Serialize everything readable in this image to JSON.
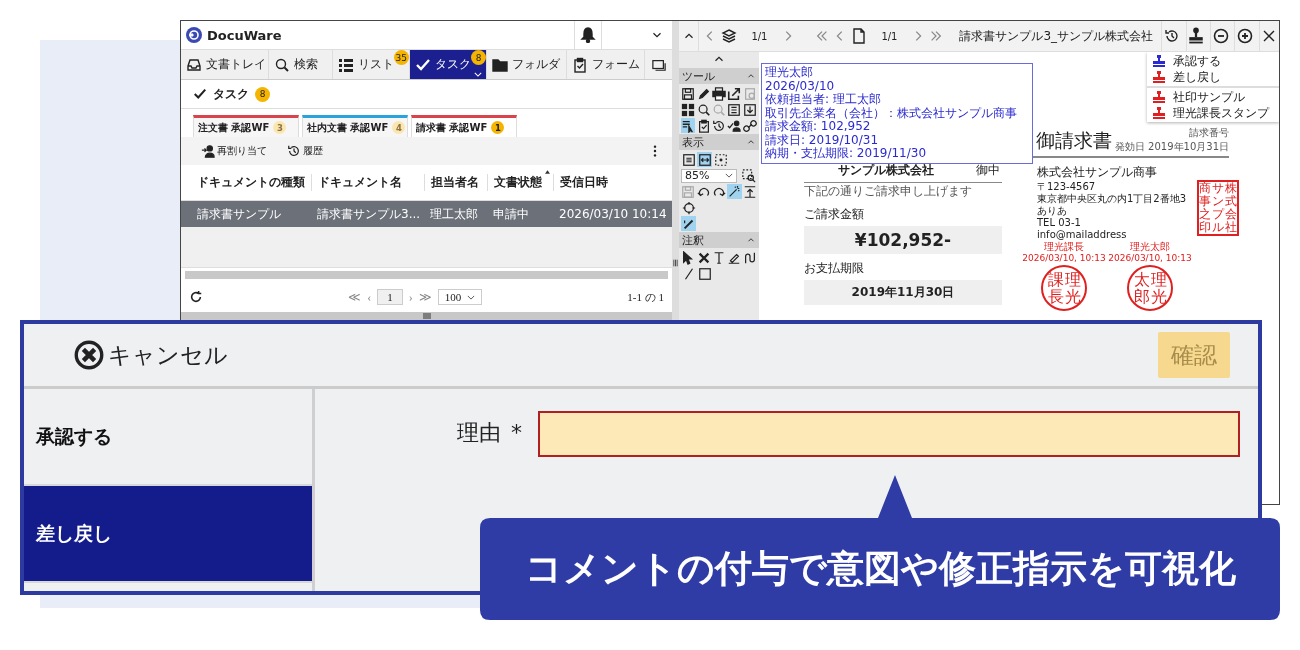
{
  "app": {
    "logo": "DocuWare",
    "nav_tabs": [
      {
        "label": "文書トレイ",
        "kind": "tray",
        "selected": false
      },
      {
        "label": "検索",
        "kind": "search",
        "selected": false
      },
      {
        "label": "リスト",
        "kind": "list",
        "badge": "35",
        "selected": false
      },
      {
        "label": "タスク",
        "kind": "check",
        "badge": "8",
        "selected": true
      },
      {
        "label": "フォルダ",
        "kind": "folder",
        "selected": false
      },
      {
        "label": "フォーム",
        "kind": "form",
        "selected": false
      }
    ],
    "page_title": "タスク",
    "page_badge": "8",
    "workflow_tabs": [
      {
        "label": "注文書 承認WF",
        "badge": "3",
        "color": "#d9434b",
        "selected": false
      },
      {
        "label": "社内文書 承認WF",
        "badge": "4",
        "color": "#2aa3dc",
        "selected": false
      },
      {
        "label": "請求書 承認WF",
        "badge": "1",
        "color": "#d9434b",
        "selected": true
      }
    ],
    "actions": [
      {
        "label": "再割り当て",
        "kind": "reassign"
      },
      {
        "label": "履歴",
        "kind": "history"
      }
    ],
    "table": {
      "columns": [
        {
          "label": "ドキュメントの種類",
          "sorted": false
        },
        {
          "label": "ドキュメント名",
          "sorted": false
        },
        {
          "label": "担当者名",
          "sorted": false
        },
        {
          "label": "文書状態",
          "sorted": true
        },
        {
          "label": "受信日時",
          "sorted": false
        }
      ],
      "rows": [
        {
          "cells": [
            "請求書サンプル",
            "請求書サンプル3...",
            "理工太郎",
            "申請中",
            "2026/03/10 10:14"
          ],
          "selected": true
        }
      ]
    },
    "pager": {
      "first": "≪",
      "prev": "‹",
      "page": "1",
      "next": "›",
      "last": "≫",
      "page_size": "100",
      "count": "1-1 の 1"
    }
  },
  "viewer": {
    "layer_page": "1/1",
    "doc_page": "1/1",
    "title": "請求書サンプル3_サンプル株式会社",
    "stamp_menu": [
      {
        "items": [
          {
            "label": "承認する",
            "color": "#2a2ad0"
          },
          {
            "label": "差し戻し",
            "color": "#e02020"
          }
        ]
      },
      {
        "items": [
          {
            "label": "社印サンプル",
            "color": "#e02020"
          },
          {
            "label": "理光課長スタンプ",
            "color": "#e02020"
          }
        ]
      }
    ],
    "tool_sections": [
      {
        "title": "ツール",
        "rows": [
          [
            {
              "kind": "save",
              "selected": false
            },
            {
              "kind": "pencil",
              "selected": false
            },
            {
              "kind": "print",
              "selected": false
            },
            {
              "kind": "export",
              "selected": false
            },
            {
              "kind": "info-doc",
              "selected": false
            }
          ],
          [
            {
              "kind": "grid",
              "selected": false
            },
            {
              "kind": "search",
              "selected": false
            },
            {
              "kind": "search-off",
              "selected": false
            },
            {
              "kind": "list-doc",
              "selected": false
            },
            {
              "kind": "download",
              "selected": false
            }
          ],
          [
            {
              "kind": "text-select",
              "selected": true
            },
            {
              "kind": "clipboard",
              "selected": false
            },
            {
              "kind": "history",
              "selected": false
            },
            {
              "kind": "sign",
              "selected": false
            },
            {
              "kind": "link",
              "selected": false
            }
          ]
        ]
      },
      {
        "title": "表示",
        "rows": [
          [
            {
              "kind": "fit-page",
              "selected": false
            },
            {
              "kind": "fit-width",
              "selected": true
            },
            {
              "kind": "fullscreen",
              "selected": false
            }
          ],
          [
            {
              "kind": "zoom-select",
              "value": "85%",
              "selected": false
            },
            {
              "kind": "zoom-area",
              "selected": false
            }
          ],
          [
            {
              "kind": "save-off",
              "selected": false
            },
            {
              "kind": "rotate-left",
              "selected": false
            },
            {
              "kind": "rotate-right",
              "selected": false
            },
            {
              "kind": "wand",
              "selected": true
            },
            {
              "kind": "align",
              "selected": false
            }
          ],
          [
            {
              "kind": "rotate",
              "selected": false
            }
          ],
          [
            {
              "kind": "pen",
              "selected": true
            }
          ]
        ]
      },
      {
        "title": "注釈",
        "rows": [
          [
            {
              "kind": "pointer",
              "selected": false
            },
            {
              "kind": "cross",
              "selected": false
            },
            {
              "kind": "text",
              "selected": false
            },
            {
              "kind": "eraser",
              "selected": false
            },
            {
              "kind": "freehand",
              "selected": false
            }
          ],
          [
            {
              "kind": "line",
              "selected": false
            },
            {
              "kind": "rect",
              "selected": false
            }
          ]
        ]
      }
    ],
    "annotation": [
      "理光太郎",
      "2026/03/10",
      "依頼担当者: 理工太郎",
      "取引先企業名（会社）：株式会社サンプル商事",
      "請求金額: 102,952",
      "請求日: 2019/10/31",
      "納期・支払期限: 2019/11/30"
    ],
    "document": {
      "title": "御請求書",
      "meta": [
        "請求番号",
        "発効日 2019年10月31日"
      ],
      "recipient": "サンプル株式会社",
      "honorific": "御中",
      "note": "下記の通りご請求申し上げます",
      "amount_label": "ご請求金額",
      "amount": "¥102,952-",
      "due_label": "お支払期限",
      "due": "2019年11月30日",
      "issuer": "株式会社サンプル商事",
      "issuer_lines": [
        "〒123-4567",
        "東京都中央区丸の内1丁目2番地3",
        "ありあ",
        "TEL 03-1",
        "info@mailaddress"
      ],
      "company_seal": [
        "商",
        "事",
        "之",
        "印",
        "サ",
        "ン",
        "プ",
        "ル",
        "株",
        "式",
        "会",
        "社"
      ],
      "stamps": [
        {
          "name": "理光課長",
          "time": "2026/03/10, 10:13",
          "seal": [
            "課",
            "長",
            "理",
            "光"
          ]
        },
        {
          "name": "理光太郎",
          "time": "2026/03/10, 10:13",
          "seal": [
            "太",
            "郎",
            "理",
            "光"
          ]
        }
      ]
    }
  },
  "dialog": {
    "cancel": "キャンセル",
    "confirm": {
      "label": "確認",
      "disabled": true
    },
    "options": [
      {
        "label": "承認する",
        "selected": false
      },
      {
        "label": "差し戻し",
        "selected": true
      }
    ],
    "field": {
      "label": "理由",
      "required": true,
      "required_mark": "*"
    }
  },
  "callout": "コメントの付与で意図や修正指示を可視化"
}
